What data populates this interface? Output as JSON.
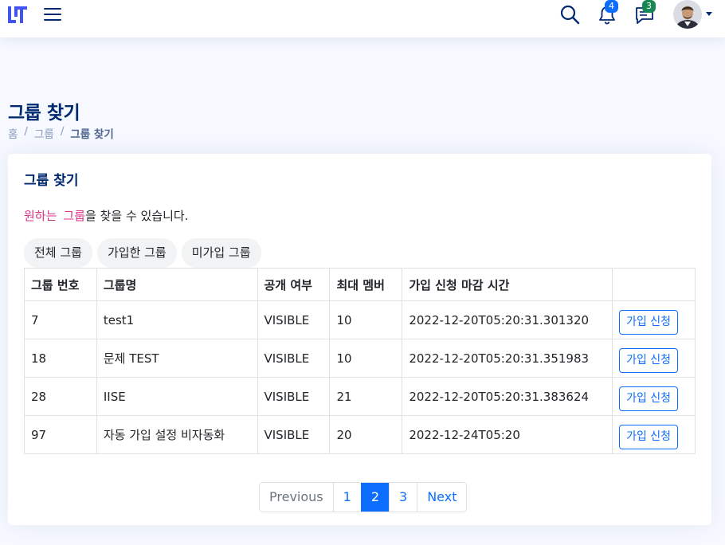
{
  "header": {
    "notifications_count": "4",
    "messages_count": "3",
    "accent_color": "#012970",
    "icons": [
      "logo-icon",
      "menu-icon",
      "search-icon",
      "bell-icon",
      "chat-icon",
      "avatar",
      "caret-down-icon"
    ]
  },
  "page": {
    "title": "그룹 찾기",
    "breadcrumb": [
      "홈",
      "그룹",
      "그룹 찾기"
    ],
    "breadcrumb_sep": "/"
  },
  "card": {
    "title": "그룹 찾기",
    "desc_hl1": "원하는",
    "desc_hl2": "그룹",
    "desc_rest": "을 찾을 수 있습니다."
  },
  "filters": [
    "전체 그룹",
    "가입한 그룹",
    "미가입 그룹"
  ],
  "table": {
    "headers": [
      "그룹 번호",
      "그룹명",
      "공개 여부",
      "최대 멤버",
      "가입 신청 마감 시간",
      ""
    ],
    "rows": [
      {
        "id": "7",
        "name": "test1",
        "visibility": "VISIBLE",
        "max": "10",
        "deadline": "2022-12-20T05:20:31.301320",
        "action": "가입 신청"
      },
      {
        "id": "18",
        "name": "문제 TEST",
        "visibility": "VISIBLE",
        "max": "10",
        "deadline": "2022-12-20T05:20:31.351983",
        "action": "가입 신청"
      },
      {
        "id": "28",
        "name": "IISE",
        "visibility": "VISIBLE",
        "max": "21",
        "deadline": "2022-12-20T05:20:31.383624",
        "action": "가입 신청"
      },
      {
        "id": "97",
        "name": "자동 가입 설정 비자동화",
        "visibility": "VISIBLE",
        "max": "20",
        "deadline": "2022-12-24T05:20",
        "action": "가입 신청"
      }
    ]
  },
  "pagination": {
    "previous": "Previous",
    "pages": [
      "1",
      "2",
      "3"
    ],
    "active_page": "2",
    "next": "Next"
  }
}
